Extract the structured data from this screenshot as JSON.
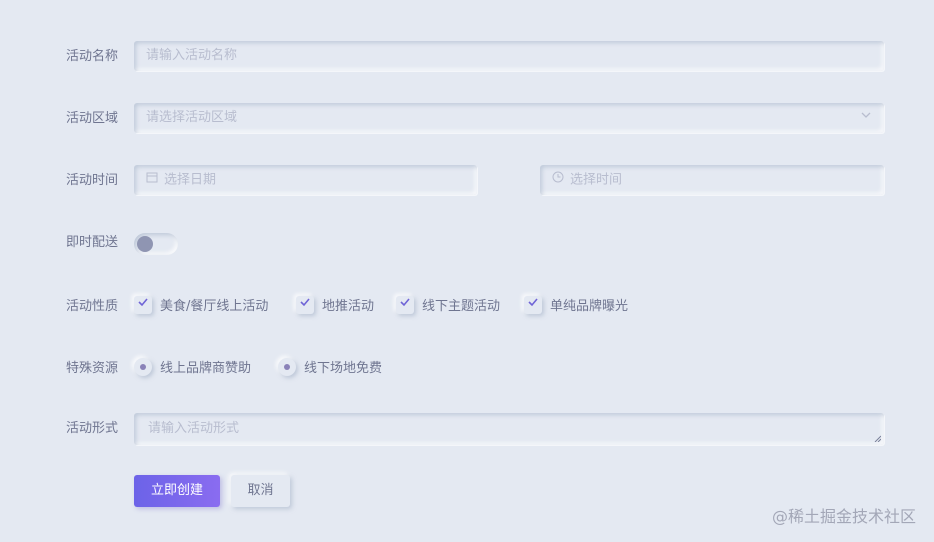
{
  "fields": {
    "name": {
      "label": "活动名称",
      "placeholder": "请输入活动名称"
    },
    "region": {
      "label": "活动区域",
      "placeholder": "请选择活动区域"
    },
    "time": {
      "label": "活动时间",
      "date_placeholder": "选择日期",
      "time_placeholder": "选择时间"
    },
    "delivery": {
      "label": "即时配送",
      "on": false
    },
    "nature": {
      "label": "活动性质",
      "options": [
        {
          "label": "美食/餐厅线上活动",
          "checked": true
        },
        {
          "label": "地推活动",
          "checked": true
        },
        {
          "label": "线下主题活动",
          "checked": true
        },
        {
          "label": "单纯品牌曝光",
          "checked": true
        }
      ]
    },
    "resource": {
      "label": "特殊资源",
      "options": [
        {
          "label": "线上品牌商赞助",
          "selected": true
        },
        {
          "label": "线下场地免费",
          "selected": true
        }
      ]
    },
    "form": {
      "label": "活动形式",
      "placeholder": "请输入活动形式"
    }
  },
  "actions": {
    "create_label": "立即创建",
    "cancel_label": "取消"
  },
  "watermark": "@稀土掘金技术社区",
  "colors": {
    "accent": "#6c63e8",
    "background": "#e4e9f2",
    "check": "#6f64d6"
  }
}
